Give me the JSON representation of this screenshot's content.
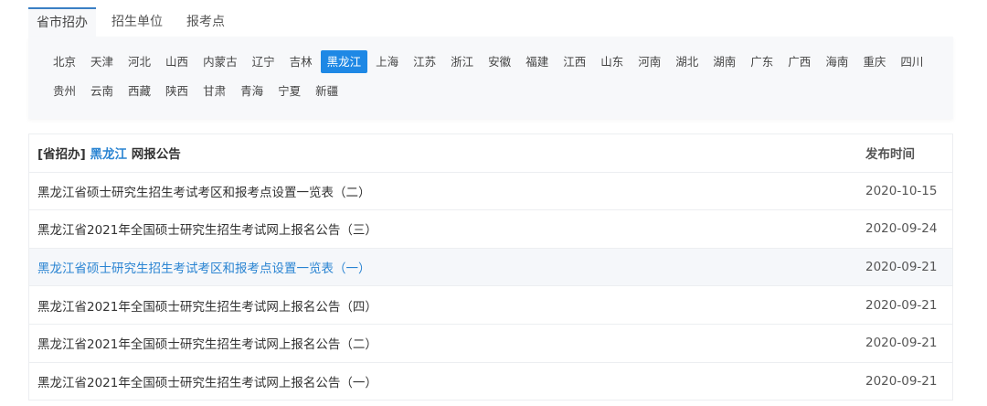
{
  "tabs": [
    "省市招办",
    "招生单位",
    "报考点"
  ],
  "provinces_row1": [
    "北京",
    "天津",
    "河北",
    "山西",
    "内蒙古",
    "辽宁",
    "吉林",
    "黑龙江",
    "上海",
    "江苏",
    "浙江",
    "安徽",
    "福建",
    "江西",
    "山东",
    "河南",
    "湖北",
    "湖南",
    "广东",
    "广西",
    "海南",
    "重庆",
    "四川"
  ],
  "provinces_row2": [
    "贵州",
    "云南",
    "西藏",
    "陕西",
    "甘肃",
    "青海",
    "宁夏",
    "新疆"
  ],
  "selected_province": "黑龙江",
  "table": {
    "header_prefix": "[省招办]",
    "header_province": "黑龙江",
    "header_suffix": "网报公告",
    "date_header": "发布时间",
    "rows": [
      {
        "title": "黑龙江省硕士研究生招生考试考区和报考点设置一览表（二）",
        "date": "2020-10-15"
      },
      {
        "title": "黑龙江省2021年全国硕士研究生招生考试网上报名公告（三）",
        "date": "2020-09-24"
      },
      {
        "title": "黑龙江省硕士研究生招生考试考区和报考点设置一览表（一）",
        "date": "2020-09-21"
      },
      {
        "title": "黑龙江省2021年全国硕士研究生招生考试网上报名公告（四）",
        "date": "2020-09-21"
      },
      {
        "title": "黑龙江省2021年全国硕士研究生招生考试网上报名公告（二）",
        "date": "2020-09-21"
      },
      {
        "title": "黑龙江省2021年全国硕士研究生招生考试网上报名公告（一）",
        "date": "2020-09-21"
      }
    ]
  }
}
